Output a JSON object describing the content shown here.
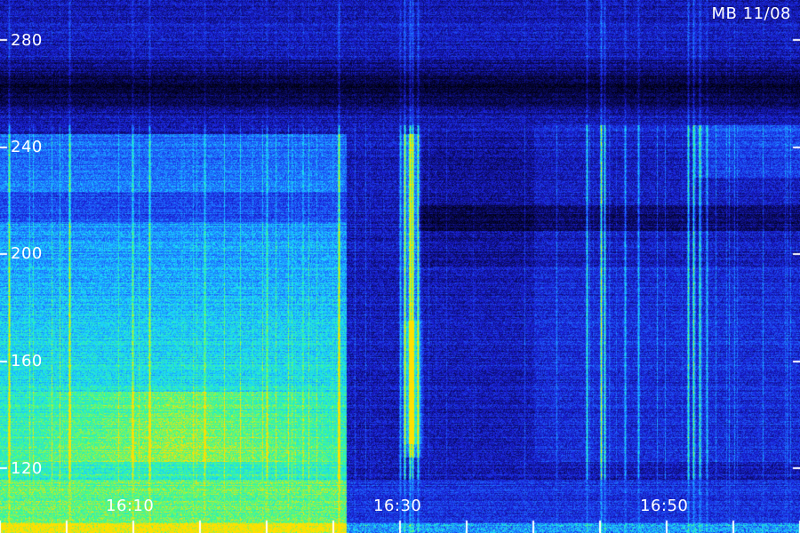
{
  "header": {
    "title": "MB 11/08"
  },
  "chart_data": {
    "type": "heatmap",
    "title": "MB 11/08",
    "xlabel": "",
    "ylabel": "",
    "x_ticks": [
      "16:10",
      "16:30",
      "16:50"
    ],
    "y_ticks": [
      "280",
      "240",
      "200",
      "160",
      "120"
    ],
    "xlim": [
      "16:02",
      "17:01"
    ],
    "ylim": [
      110,
      285
    ],
    "colormap": [
      "#000010",
      "#0a0a60",
      "#1a20d8",
      "#1e6cff",
      "#19d6ff",
      "#3cff8c",
      "#ffe000"
    ],
    "grid": false
  },
  "colors": {
    "background": "#000000",
    "tick": "#ffffff",
    "text": "#ffffff"
  }
}
